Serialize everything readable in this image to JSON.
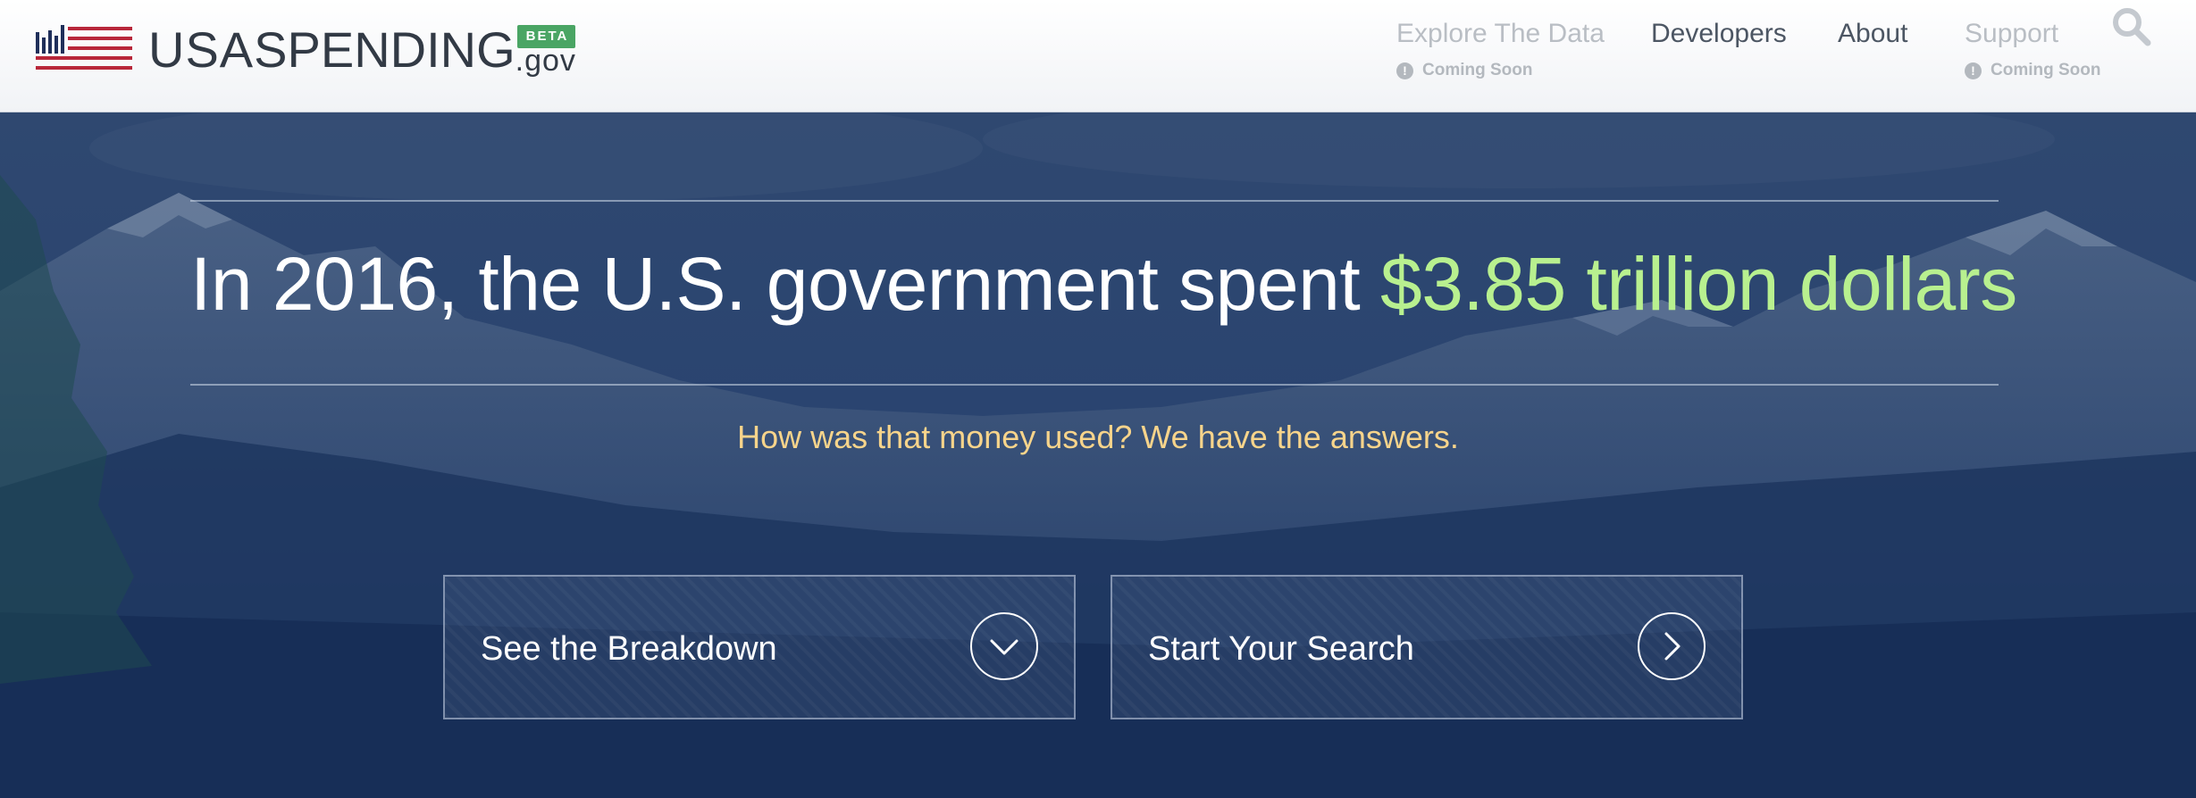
{
  "header": {
    "logo": {
      "wordmark_bold": "USA",
      "wordmark_light": "SPENDING",
      "suffix": ".gov",
      "badge": "BETA"
    },
    "nav": [
      {
        "label": "Explore The Data",
        "status": "Coming Soon",
        "enabled": false
      },
      {
        "label": "Developers",
        "enabled": true
      },
      {
        "label": "About",
        "enabled": true
      },
      {
        "label": "Support",
        "status": "Coming Soon",
        "enabled": false
      }
    ],
    "search_icon": "search-icon"
  },
  "hero": {
    "headline_prefix": "In 2016, the U.S. government spent ",
    "headline_amount": "$3.85 trillion dollars",
    "subhead": "How was that money used? We have the answers.",
    "cta": [
      {
        "label": "See the Breakdown",
        "icon": "chevron-down-icon"
      },
      {
        "label": "Start Your Search",
        "icon": "chevron-right-icon"
      }
    ]
  },
  "colors": {
    "hero_background": "#1c3560",
    "headline_accent": "#b8f08f",
    "subhead": "#f7d48b",
    "badge": "#4aa564",
    "flag_red": "#b8273a",
    "flag_navy": "#1f2f5a"
  }
}
